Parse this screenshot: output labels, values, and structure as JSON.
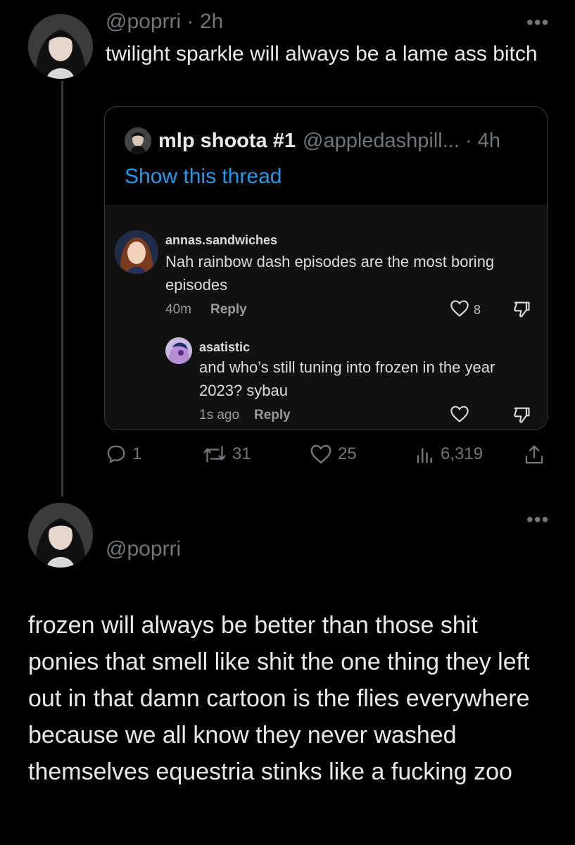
{
  "tweet": {
    "handle": "@poprri",
    "time": "2h",
    "text": "twilight sparkle will always be a lame ass bitch",
    "more": "•••"
  },
  "quote": {
    "name": "mlp shoota #1",
    "handle": "@appledashpill...",
    "time": "4h",
    "show_thread": "Show this thread",
    "comments": [
      {
        "user": "annas.sandwiches",
        "text": "Nah rainbow dash episodes are the most boring episodes",
        "time": "40m",
        "reply": "Reply",
        "likes": "8"
      },
      {
        "user": "asatistic",
        "text": "and who’s still tuning into frozen in the year 2023? sybau",
        "time": "1s ago",
        "reply": "Reply"
      }
    ]
  },
  "actions": {
    "replies": "1",
    "retweets": "31",
    "likes": "25",
    "views": "6,319"
  },
  "reply_tweet": {
    "handle": "@poprri",
    "more": "•••",
    "text": "frozen will always be better than those shit ponies that smell like shit the one thing they left out in that damn cartoon is the flies everywhere because we all know they never washed themselves equestria stinks like a fucking zoo"
  },
  "colors": {
    "background": "#000000",
    "text": "#e7e9ea",
    "muted": "#71767b",
    "link": "#1d9bf0"
  }
}
